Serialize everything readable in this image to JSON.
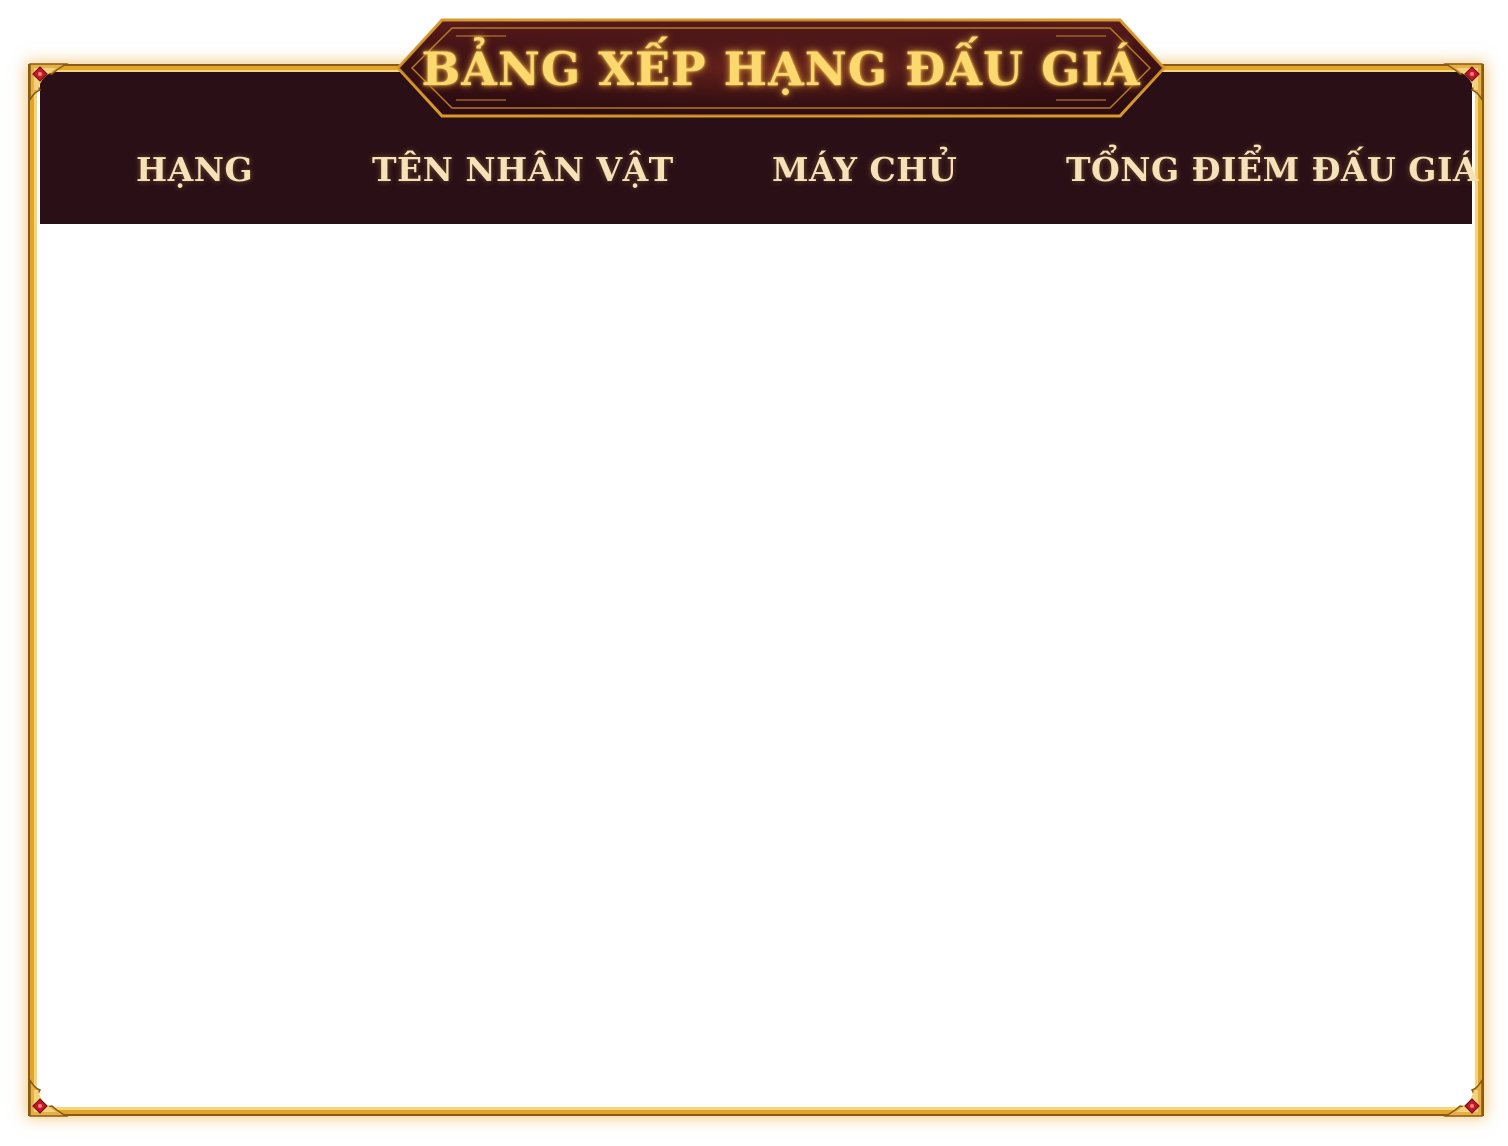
{
  "leaderboard": {
    "title": "BẢNG XẾP HẠNG ĐẤU GIÁ",
    "columns": {
      "rank": "HẠNG",
      "character_name": "TÊN NHÂN VẬT",
      "server": "MÁY CHỦ",
      "total_auction_points": "TỔNG ĐIỂM ĐẤU GIÁ"
    },
    "rows": []
  },
  "colors": {
    "frame_gold": "#e0a52a",
    "header_dark": "#2a1016",
    "title_gold": "#fbd96e",
    "column_text": "#f5e2b8",
    "gem_red": "#c0192a"
  },
  "icons": {
    "corner": "ornate-gold-corner-with-red-gem"
  }
}
